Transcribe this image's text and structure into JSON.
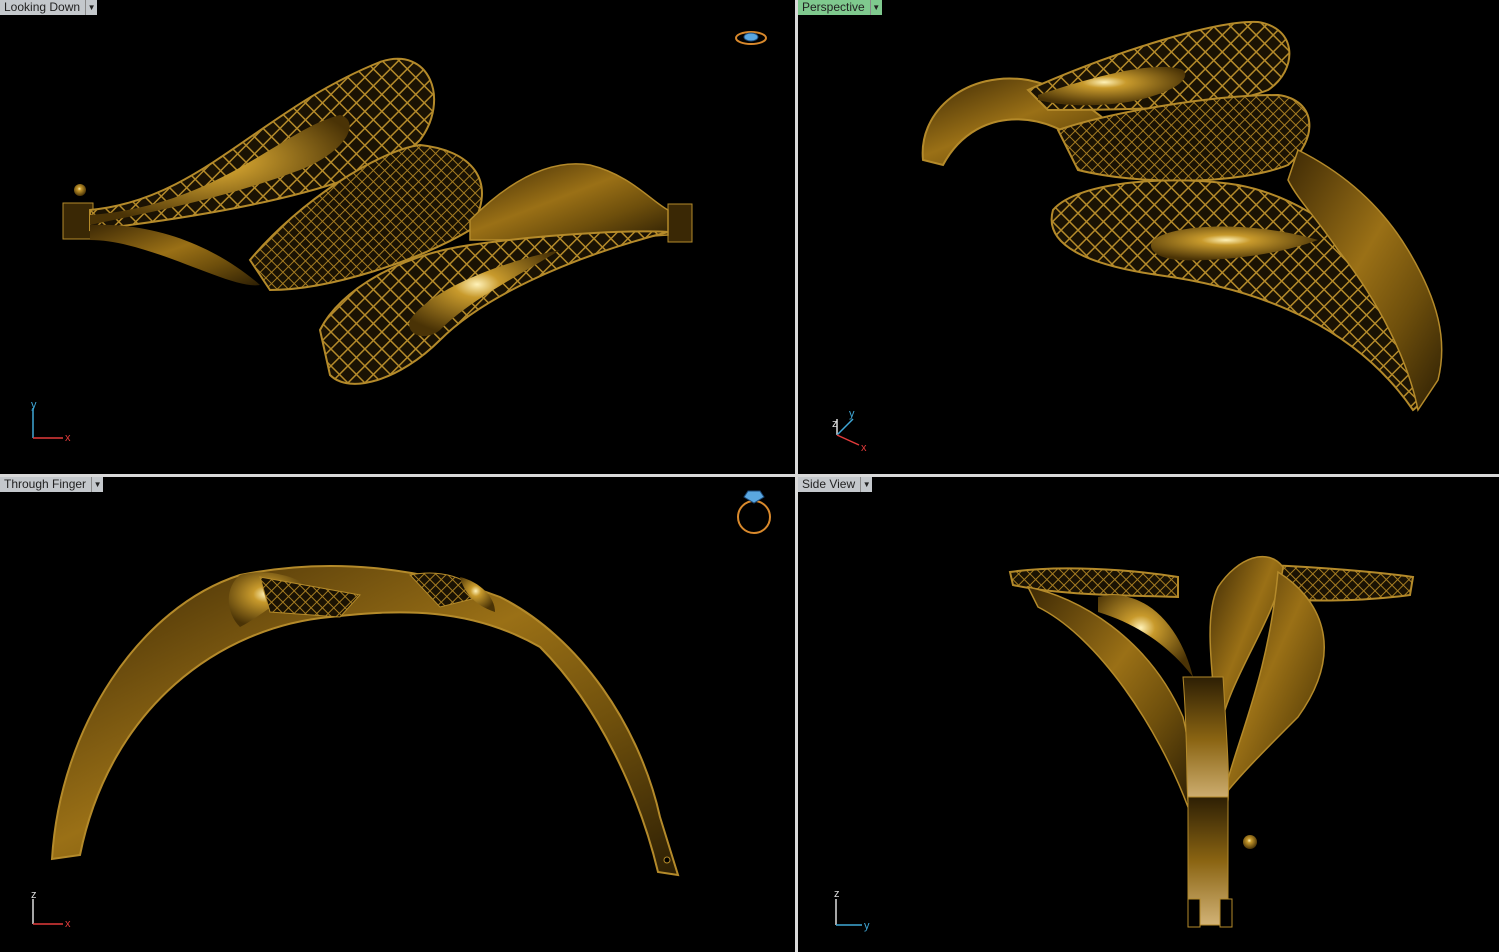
{
  "viewports": {
    "top_left": {
      "label": "Looking Down",
      "axes": {
        "vertical": "y",
        "horizontal": "x"
      }
    },
    "top_right": {
      "label": "Perspective",
      "axes": {
        "vertical": "z",
        "second": "y",
        "horizontal": "x"
      }
    },
    "bottom_left": {
      "label": "Through Finger",
      "axes": {
        "vertical": "z",
        "horizontal": "x"
      }
    },
    "bottom_right": {
      "label": "Side View",
      "axes": {
        "vertical": "z",
        "horizontal": "y"
      }
    }
  },
  "colors": {
    "gold_dark": "#5a3d05",
    "gold_mid": "#8a6412",
    "gold_light": "#c89a2c",
    "axis_x": "#e23b3b",
    "axis_y": "#3fa7d6",
    "axis_z": "#dddddd",
    "divider": "#d9d9d9",
    "active_tab": "#7fc98e"
  },
  "icons": {
    "view_gizmo_top": "ring-top-gizmo-icon",
    "view_gizmo_front": "ring-front-gizmo-icon"
  }
}
